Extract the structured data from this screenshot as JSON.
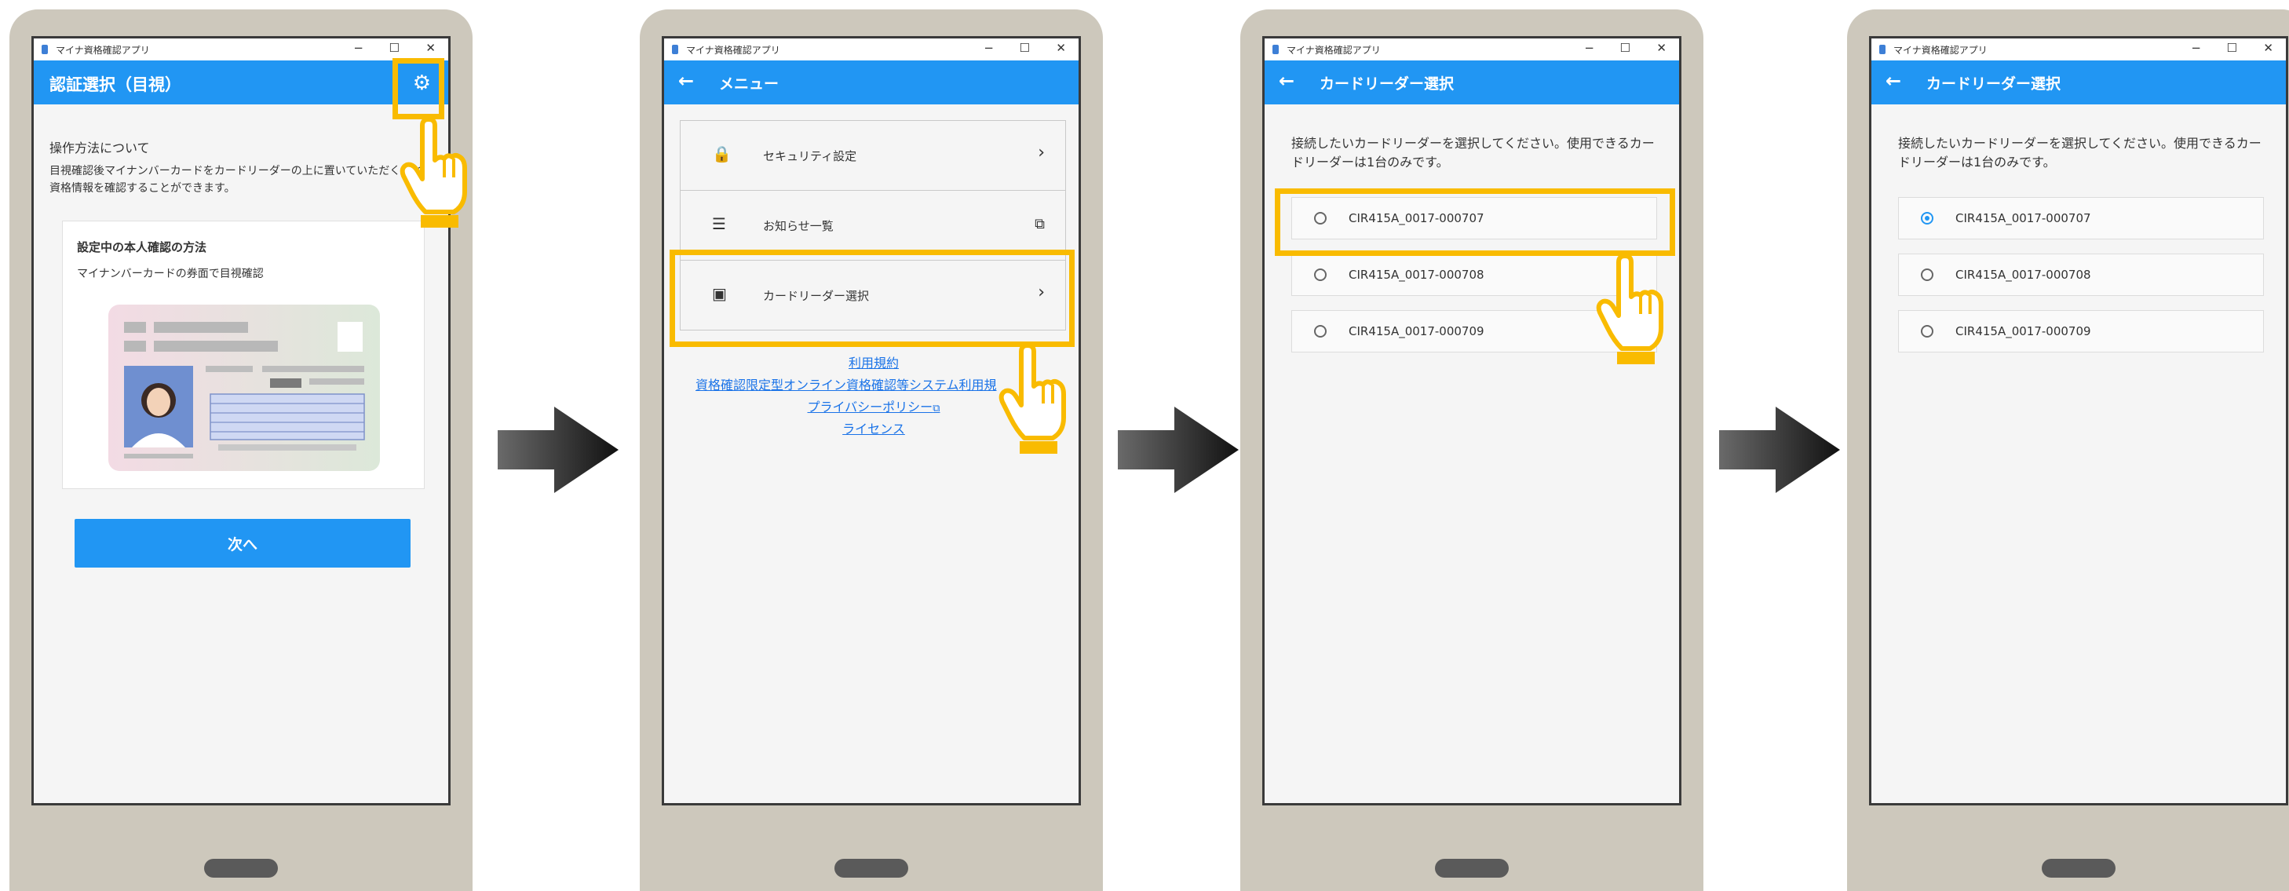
{
  "window": {
    "title": "マイナ資格確認アプリ",
    "minimize": "−",
    "maximize": "☐",
    "close": "✕"
  },
  "colors": {
    "primary": "#2196f3",
    "highlight": "#f9bb00",
    "phone_frame": "#cdc8bc"
  },
  "screen1": {
    "title": "認証選択（目視）",
    "section_heading": "操作方法について",
    "description_line1": "目視確認後マイナンバーカードをカードリーダーの上に置いていただくことで",
    "description_line2": "資格情報を確認することができます。",
    "card_heading": "設定中の本人確認の方法",
    "card_method": "マイナンバーカードの券面で目視確認",
    "next_button": "次へ",
    "icons": {
      "settings": "gear-icon"
    }
  },
  "screen2": {
    "title": "メニュー",
    "menu_items": [
      {
        "label": "セキュリティ設定",
        "icon": "lock-icon",
        "trail": "chevron-right-icon"
      },
      {
        "label": "お知らせ一覧",
        "icon": "list-icon",
        "trail": "open-external-icon"
      },
      {
        "label": "カードリーダー選択",
        "icon": "cast-icon",
        "trail": "chevron-right-icon"
      }
    ],
    "links": [
      "利用規約",
      "資格確認限定型オンライン資格確認等システム利用規",
      "プライバシーポリシー",
      "ライセンス"
    ]
  },
  "screen3": {
    "title": "カードリーダー選択",
    "instruction_line1": "接続したいカードリーダーを選択してください。使用できるカー",
    "instruction_line2": "ドリーダーは1台のみです。",
    "readers": [
      "CIR415A_0017-000707",
      "CIR415A_0017-000708",
      "CIR415A_0017-000709"
    ],
    "selected_index": -1
  },
  "screen4": {
    "title": "カードリーダー選択",
    "instruction_line1": "接続したいカードリーダーを選択してください。使用できるカー",
    "instruction_line2": "ドリーダーは1台のみです。",
    "readers": [
      "CIR415A_0017-000707",
      "CIR415A_0017-000708",
      "CIR415A_0017-000709"
    ],
    "selected_index": 0
  }
}
